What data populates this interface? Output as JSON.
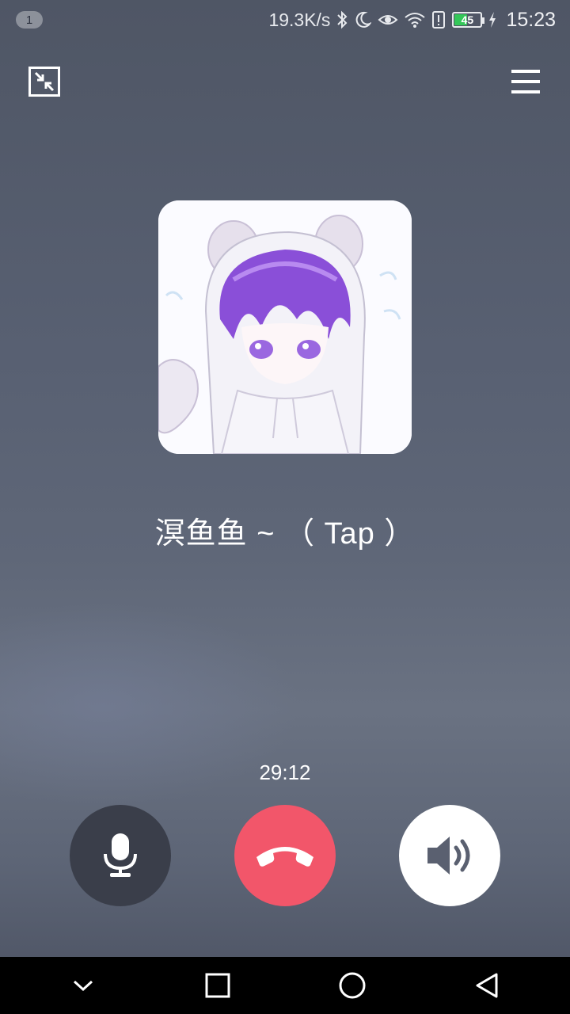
{
  "status_bar": {
    "notification_count": "1",
    "network_speed": "19.3K/s",
    "battery_level": "45",
    "time": "15:23",
    "icons": [
      "bluetooth-icon",
      "moon-icon",
      "eye-icon",
      "wifi-icon",
      "alert-icon",
      "battery-icon",
      "charging-icon"
    ]
  },
  "call": {
    "caller_name": "溟鱼鱼 ~ （ Tap ）",
    "duration": "29:12"
  },
  "controls": {
    "mute": "microphone-icon",
    "hangup": "phone-hangup-icon",
    "speaker": "speaker-icon"
  },
  "colors": {
    "hangup": "#f2566a",
    "mute_bg": "#3a3e4a",
    "speaker_bg": "#ffffff"
  }
}
